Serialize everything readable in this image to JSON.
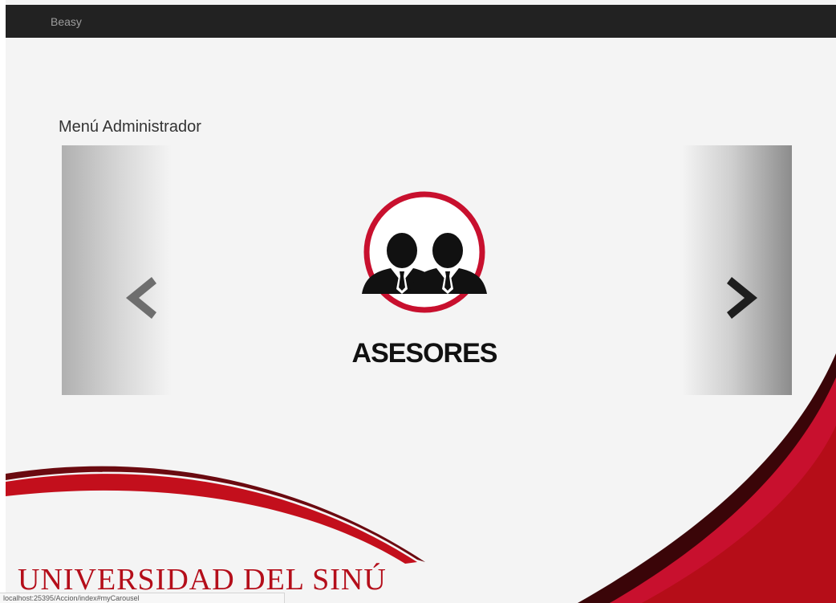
{
  "navbar": {
    "brand": "Beasy"
  },
  "main": {
    "title": "Menú Administrador"
  },
  "carousel": {
    "slide": {
      "caption": "ASESORES",
      "icon": "advisors-icon"
    },
    "controls": {
      "prev_icon": "chevron-left-icon",
      "next_icon": "chevron-right-icon"
    }
  },
  "footer": {
    "institution": "UNIVERSIDAD DEL SINÚ"
  },
  "status_bar": {
    "url": "localhost:25395/Accion/index#myCarousel"
  },
  "colors": {
    "navbar": "#222222",
    "brand_text": "#9d9d9d",
    "accent_red": "#c8102e",
    "page_bg": "#f4f4f4"
  }
}
